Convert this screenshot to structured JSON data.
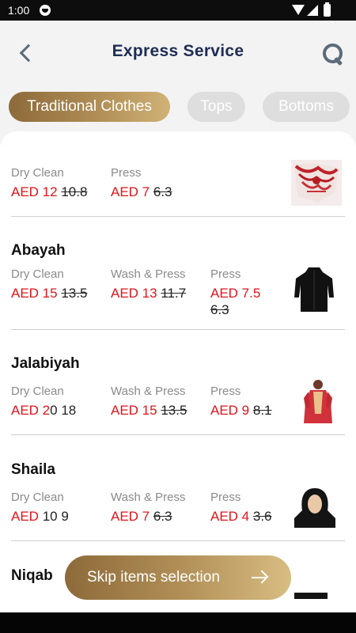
{
  "status_bar": {
    "time": "1:00"
  },
  "header": {
    "title": "Express Service"
  },
  "tabs": [
    {
      "label": "Traditional Clothes",
      "active": true
    },
    {
      "label": "Tops",
      "active": false
    },
    {
      "label": "Bottoms",
      "active": false
    }
  ],
  "items": [
    {
      "name": "",
      "image": "red-embroidered-cloth",
      "services": [
        {
          "label": "Dry Clean",
          "price": "AED 12",
          "old_price": "10.8"
        },
        {
          "label": "Press",
          "price": "AED 7",
          "old_price": "6.3"
        }
      ]
    },
    {
      "name": "Abayah",
      "image": "black-abayah",
      "services": [
        {
          "label": "Dry Clean",
          "price": "AED 15",
          "old_price": "13.5"
        },
        {
          "label": "Wash & Press",
          "price": "AED 13",
          "old_price": "11.7"
        },
        {
          "label": "Press",
          "price": "AED 7.5",
          "old_price": "6.3"
        }
      ]
    },
    {
      "name": "Jalabiyah",
      "image": "red-jalabiyah",
      "services": [
        {
          "label": "Dry Clean",
          "price": "AED 2",
          "price_tail": "0",
          "old_price": "18"
        },
        {
          "label": "Wash & Press",
          "price": "AED 15",
          "old_price": "13.5"
        },
        {
          "label": "Press",
          "price": "AED 9",
          "old_price": "8.1"
        }
      ]
    },
    {
      "name": "Shaila",
      "image": "black-shaila",
      "services": [
        {
          "label": "Dry Clean",
          "price": "AED",
          "price_tail": "10",
          "old_price": "9"
        },
        {
          "label": "Wash & Press",
          "price": "AED 7",
          "old_price": "6.3"
        },
        {
          "label": "Press",
          "price": "AED 4",
          "old_price": "3.6"
        }
      ]
    },
    {
      "name": "Niqab",
      "image": "black-niqab"
    }
  ],
  "cta": {
    "label": "Skip items selection"
  },
  "colors": {
    "accent_gold": "#b08e56",
    "price_red": "#e0141b",
    "title_navy": "#1f2d55"
  }
}
